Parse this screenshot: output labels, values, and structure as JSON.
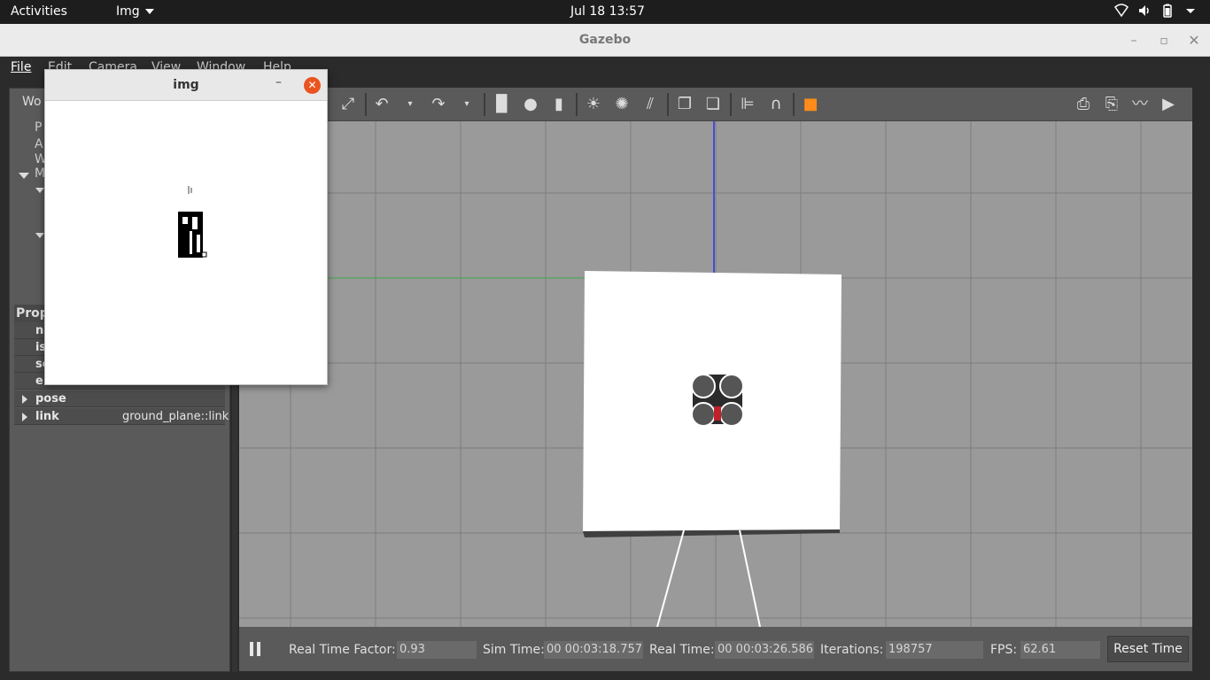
{
  "topbar": {
    "activities": "Activities",
    "app_menu": "Img",
    "clock": "Jul 18  13:57",
    "icons": [
      "network-icon",
      "volume-icon",
      "battery-icon",
      "system-menu-icon"
    ]
  },
  "window": {
    "title": "Gazebo"
  },
  "menu": {
    "file": "File",
    "edit": "Edit",
    "camera": "Camera",
    "view": "View",
    "window": "Window",
    "help": "Help"
  },
  "left_panel": {
    "tab_label": "Wo",
    "tree_items": [
      "P",
      "A",
      "W",
      "M"
    ],
    "properties_header": "Prop",
    "rows": [
      {
        "key": "na",
        "value": ""
      },
      {
        "key": "is",
        "value": ""
      },
      {
        "key": "se",
        "value": ""
      },
      {
        "key": "en",
        "value": ""
      }
    ],
    "expandable_rows": [
      {
        "key": "pose",
        "value": ""
      },
      {
        "key": "link",
        "value": "ground_plane::link"
      }
    ]
  },
  "popup": {
    "title": "img",
    "minimize": "–",
    "close": "✕"
  },
  "status": {
    "rtf_label": "Real Time Factor:",
    "rtf_value": "0.93",
    "sim_label": "Sim Time:",
    "sim_value": "00 00:03:18.757",
    "real_label": "Real Time:",
    "real_value": "00 00:03:26.586",
    "iter_label": "Iterations:",
    "iter_value": "198757",
    "fps_label": "FPS:",
    "fps_value": "62.61",
    "reset_button": "Reset Time"
  },
  "colors": {
    "accent_close": "#e95420",
    "viewport_bg": "#9a9a9a",
    "panel_bg": "#5a5a5a",
    "topbar_bg": "#1d1d1d"
  }
}
